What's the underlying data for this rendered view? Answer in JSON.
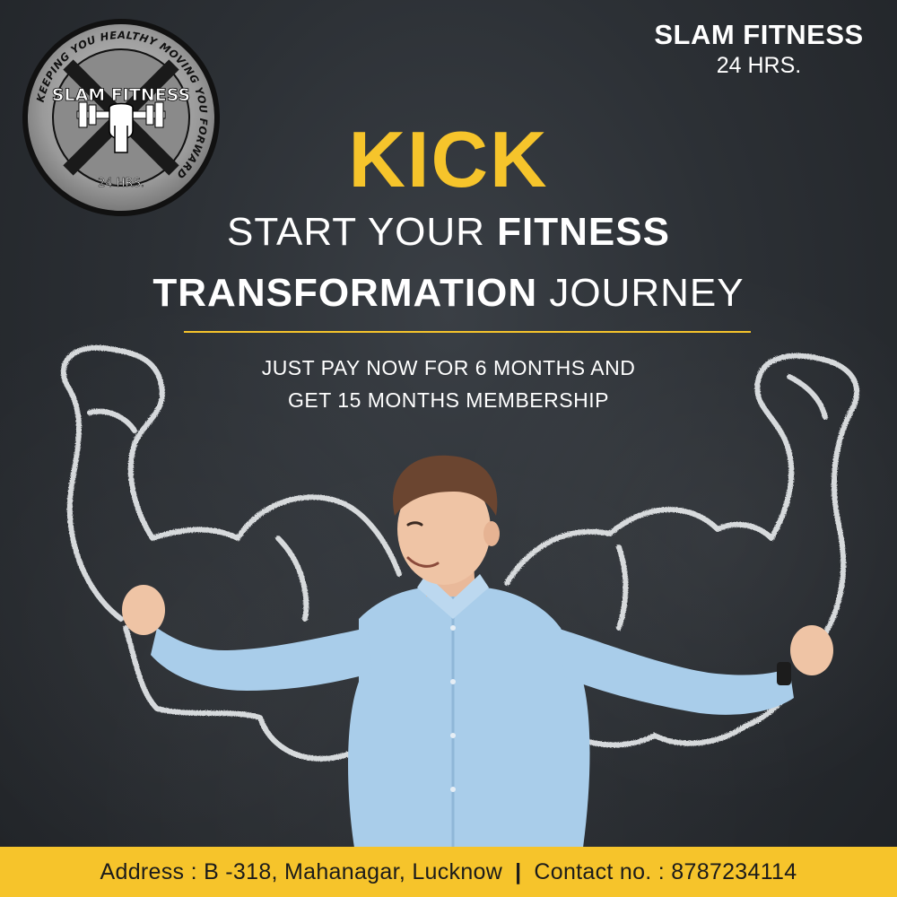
{
  "brand": {
    "name": "SLAM FITNESS",
    "hours": "24 HRS."
  },
  "logo": {
    "ring_text": "KEEPING YOU HEALTHY MOVING YOU FORWARD",
    "name": "SLAM FITNESS",
    "hours": "24 HRS.",
    "icon": "dumbbell-fist-icon"
  },
  "headline": {
    "kick": "KICK",
    "line2_regular": "START YOUR ",
    "line2_bold": "FITNESS",
    "line3_bold": "TRANSFORMATION",
    "line3_regular": " JOURNEY"
  },
  "offer": {
    "line1": "JUST PAY NOW FOR 6 MONTHS AND",
    "line2": "GET 15 MONTHS MEMBERSHIP"
  },
  "footer": {
    "address": "Address : B -318, Mahanagar, Lucknow",
    "separator": "|",
    "contact": "Contact no. : 8787234114"
  },
  "colors": {
    "accent": "#f6c42b",
    "background": "#2c3035",
    "shirt": "#a9cdea",
    "chalk": "#e9ecee"
  }
}
